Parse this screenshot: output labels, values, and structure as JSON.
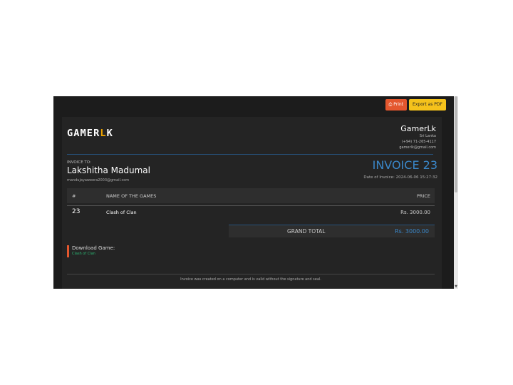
{
  "toolbar": {
    "print_label": "Print",
    "pdf_label": "Export as PDF",
    "print_icon": "printer-icon"
  },
  "brand": {
    "logo_prefix": "GAMER",
    "logo_accent": "L",
    "logo_suffix": "K",
    "accent_color": "#f0a500"
  },
  "company": {
    "name": "GamerLk",
    "country": "Sri Lanka",
    "phone": "(+94) 71-265-4117",
    "email": "gamerlk@gmail.com"
  },
  "billing": {
    "label": "INVOICE TO:",
    "name": "Lakshitha Madumal",
    "email": "mandujayaweera2003@gmail.com"
  },
  "invoice": {
    "title": "INVOICE 23",
    "date": "Date of Invoice: 2024-06-06 15:27:32"
  },
  "table": {
    "headers": {
      "no": "#",
      "name": "NAME OF THE GAMES",
      "price": "PRICE"
    },
    "rows": [
      {
        "no": "23",
        "name": "Clash of Clan",
        "price": "Rs. 3000.00"
      }
    ]
  },
  "totals": {
    "label": "GRAND TOTAL",
    "value": "Rs. 3000.00"
  },
  "download": {
    "title": "Download Game:",
    "link": "Clash of Clan"
  },
  "footer": {
    "note": "Invoice was created on a computer and is valid without the signature and seal."
  },
  "colors": {
    "accent_blue": "#3a87c9",
    "print_button": "#e4572e",
    "pdf_button": "#f5c21b",
    "link_green": "#2bb673"
  }
}
